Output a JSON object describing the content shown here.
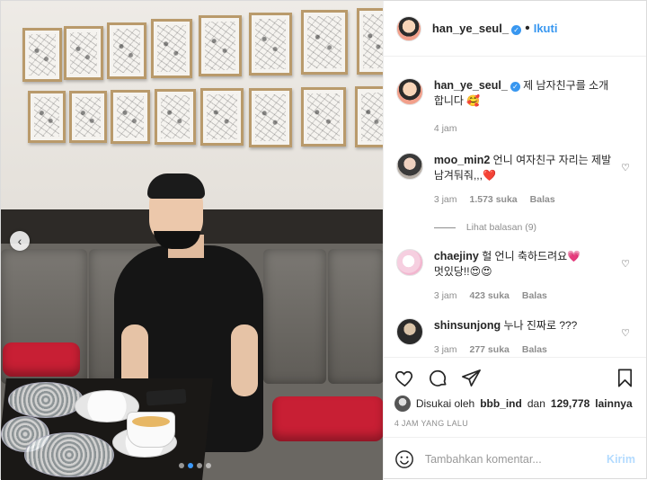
{
  "post": {
    "username": "han_ye_seul_",
    "follow_label": "Ikuti",
    "separator": "•",
    "caption": "제 남자친구를 소개합니다",
    "caption_emoji": "🥰",
    "caption_time": "4 jam"
  },
  "comments": [
    {
      "username": "moo_min2",
      "text": "언니 여자친구 자리는 제발 남겨둬줘,,,",
      "emoji": "❤️",
      "time": "3 jam",
      "likes": "1.573 suka",
      "reply": "Balas",
      "view_replies": "Lihat balasan (9)"
    },
    {
      "username": "chaejiny",
      "text": "헐 언니 축하드려요",
      "text2": "멋있당!!",
      "emoji": "💗",
      "emoji2": "😍😍",
      "time": "3 jam",
      "likes": "423 suka",
      "reply": "Balas"
    },
    {
      "username": "shinsunjong",
      "text": "누나 진짜로 ???",
      "time": "3 jam",
      "likes": "277 suka",
      "reply": "Balas"
    }
  ],
  "actions": {
    "liked_by_prefix": "Disukai oleh",
    "liked_by_user": "bbb_ind",
    "liked_by_mid": "dan",
    "liked_by_count": "129,778",
    "liked_by_suffix": "lainnya",
    "time_ago": "4 JAM YANG LALU"
  },
  "comment_box": {
    "placeholder": "Tambahkan komentar...",
    "post_label": "Kirim"
  },
  "carousel": {
    "total_slides": 4,
    "active_slide": 2
  },
  "colors": {
    "accent": "#3897f0",
    "post_button_disabled": "#b3dbff",
    "muted": "#8e8e8e"
  }
}
